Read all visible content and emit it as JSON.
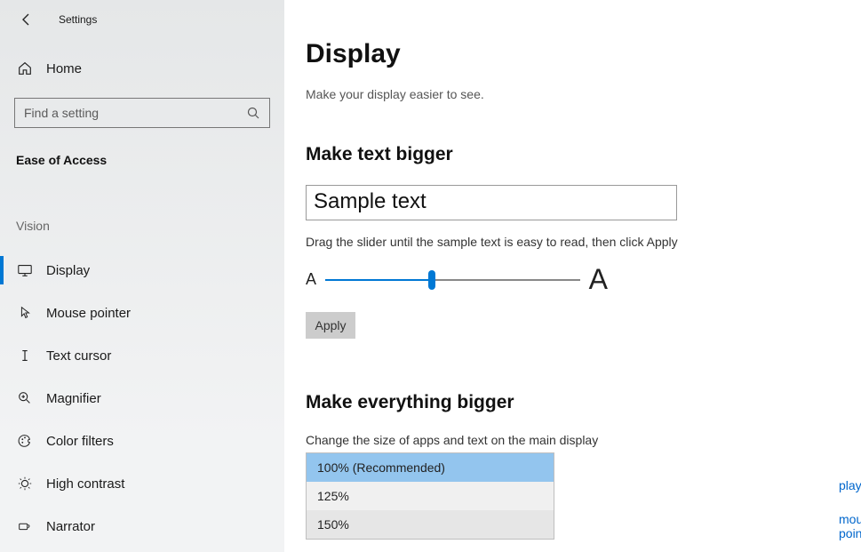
{
  "header": {
    "settings_label": "Settings"
  },
  "sidebar": {
    "home_label": "Home",
    "search_placeholder": "Find a setting",
    "group_title": "Ease of Access",
    "section_label": "Vision",
    "items": [
      {
        "label": "Display",
        "icon": "display",
        "active": true
      },
      {
        "label": "Mouse pointer",
        "icon": "pointer",
        "active": false
      },
      {
        "label": "Text cursor",
        "icon": "textcursor",
        "active": false
      },
      {
        "label": "Magnifier",
        "icon": "magnifier",
        "active": false
      },
      {
        "label": "Color filters",
        "icon": "palette",
        "active": false
      },
      {
        "label": "High contrast",
        "icon": "contrast",
        "active": false
      },
      {
        "label": "Narrator",
        "icon": "narrator",
        "active": false
      }
    ]
  },
  "main": {
    "title": "Display",
    "subtitle": "Make your display easier to see.",
    "text_bigger": {
      "heading": "Make text bigger",
      "sample": "Sample text",
      "instruction": "Drag the slider until the sample text is easy to read, then click Apply",
      "small_a": "A",
      "big_a": "A",
      "apply_label": "Apply"
    },
    "everything_bigger": {
      "heading": "Make everything bigger",
      "subheading": "Change the size of apps and text on the main display",
      "options": [
        "100% (Recommended)",
        "125%",
        "150%"
      ]
    },
    "link_fragment_1": "plays",
    "link_fragment_2": "mouse pointer"
  }
}
